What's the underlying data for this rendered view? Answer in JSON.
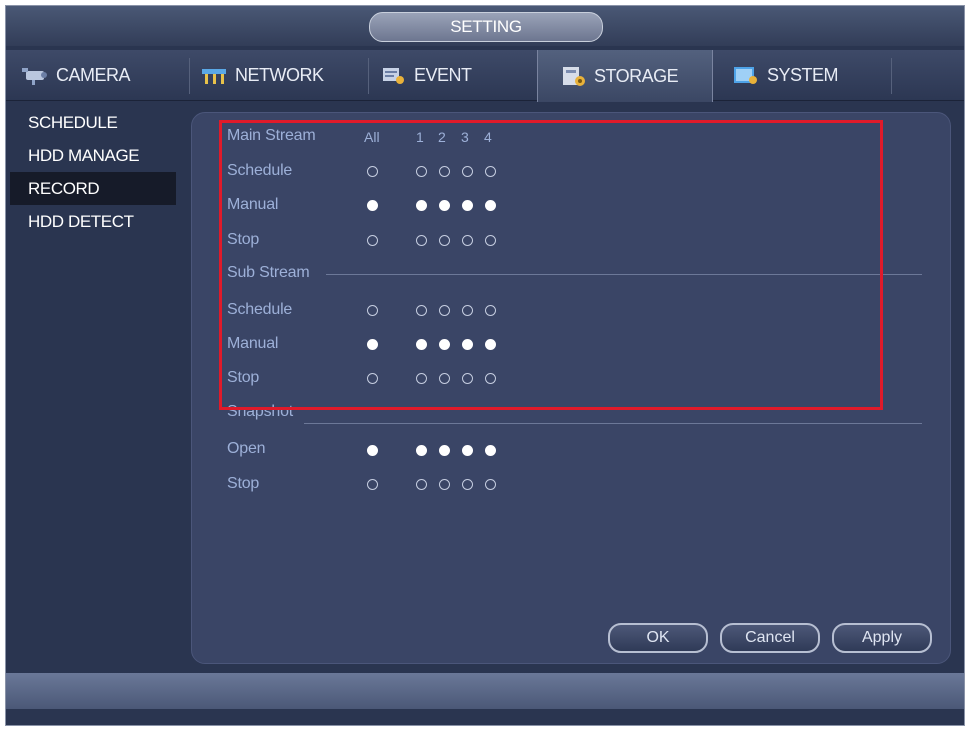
{
  "window": {
    "title": "SETTING"
  },
  "tabs": [
    {
      "label": "CAMERA",
      "icon": "camera-icon",
      "active": false
    },
    {
      "label": "NETWORK",
      "icon": "network-icon",
      "active": false
    },
    {
      "label": "EVENT",
      "icon": "event-icon",
      "active": false
    },
    {
      "label": "STORAGE",
      "icon": "storage-icon",
      "active": true
    },
    {
      "label": "SYSTEM",
      "icon": "system-icon",
      "active": false
    }
  ],
  "sidebar": {
    "items": [
      {
        "label": "SCHEDULE",
        "active": false
      },
      {
        "label": "HDD MANAGE",
        "active": false
      },
      {
        "label": "RECORD",
        "active": true
      },
      {
        "label": "HDD DETECT",
        "active": false
      }
    ]
  },
  "record": {
    "main_stream": {
      "title": "Main Stream",
      "columns": {
        "all": "All",
        "channels": [
          "1",
          "2",
          "3",
          "4"
        ]
      },
      "rows": [
        {
          "label": "Schedule",
          "selected": false
        },
        {
          "label": "Manual",
          "selected": true
        },
        {
          "label": "Stop",
          "selected": false
        }
      ]
    },
    "sub_stream": {
      "title": "Sub Stream",
      "rows": [
        {
          "label": "Schedule",
          "selected": false
        },
        {
          "label": "Manual",
          "selected": true
        },
        {
          "label": "Stop",
          "selected": false
        }
      ]
    },
    "snapshot": {
      "title": "Snapshot",
      "rows": [
        {
          "label": "Open",
          "selected": true
        },
        {
          "label": "Stop",
          "selected": false
        }
      ]
    }
  },
  "buttons": {
    "ok": "OK",
    "cancel": "Cancel",
    "apply": "Apply"
  },
  "colors": {
    "highlight_box": "#e01a2a",
    "background": "#2a3550",
    "label": "#9db0d8"
  }
}
